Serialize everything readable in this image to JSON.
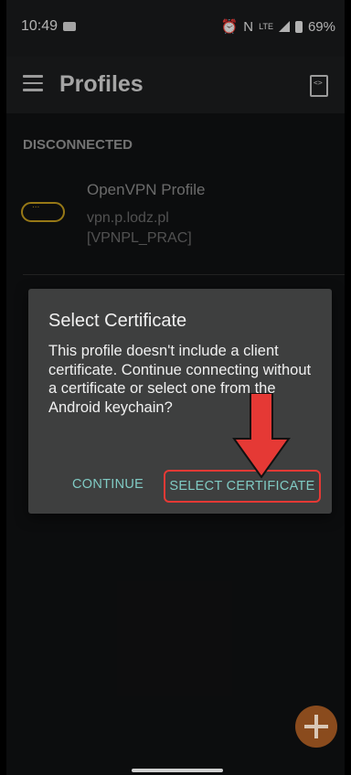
{
  "status_bar": {
    "time": "10:49",
    "lte": "LTE",
    "battery": "69%"
  },
  "app_bar": {
    "title": "Profiles",
    "menu_icon": "hamburger-menu-icon",
    "import_icon": "import-profile-icon"
  },
  "section": {
    "header": "DISCONNECTED"
  },
  "profile": {
    "name": "OpenVPN Profile",
    "server": "vpn.p.lodz.pl [VPNPL_PRAC]",
    "icon": "key-icon"
  },
  "dialog": {
    "title": "Select Certificate",
    "message": "This profile doesn't include a client certificate. Continue connecting without a certificate or select one from the Android keychain?",
    "continue_label": "CONTINUE",
    "select_label": "SELECT CERTIFICATE"
  },
  "colors": {
    "accent_text": "#80cbc4",
    "highlight": "#e53935",
    "key_icon": "#caa11e",
    "fab": "#8a4b1d"
  }
}
